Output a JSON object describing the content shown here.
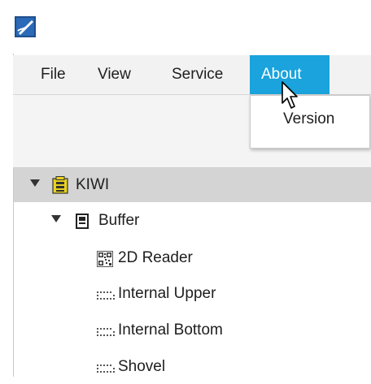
{
  "menubar": {
    "items": [
      {
        "label": "File"
      },
      {
        "label": "View"
      },
      {
        "label": "Service"
      },
      {
        "label": "About"
      }
    ]
  },
  "dropdown": {
    "items": [
      {
        "label": "Version"
      }
    ]
  },
  "tree": {
    "root": {
      "label": "KIWI"
    },
    "group": {
      "label": "Buffer"
    },
    "children": [
      {
        "label": "2D Reader",
        "icon": "qr-code-icon"
      },
      {
        "label": "Internal Upper",
        "icon": "grid-slot-icon"
      },
      {
        "label": "Internal Bottom",
        "icon": "grid-slot-icon"
      },
      {
        "label": "Shovel",
        "icon": "grid-slot-icon"
      }
    ]
  },
  "colors": {
    "menu_active_bg": "#1aa3dc",
    "tree_selected_bg": "#d4d4d4",
    "menubar_bg": "#f2f2f2"
  }
}
